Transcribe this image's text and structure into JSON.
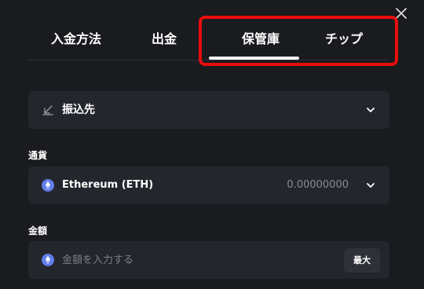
{
  "tabs": {
    "deposit": "入金方法",
    "withdraw": "出金",
    "vault": "保管庫",
    "tip": "チップ"
  },
  "destination": {
    "label": "振込先"
  },
  "currency": {
    "section_label": "通貨",
    "name": "Ethereum (ETH)",
    "balance": "0.00000000"
  },
  "amount": {
    "section_label": "金額",
    "placeholder": "金額を入力する",
    "max_label": "最大"
  },
  "colors": {
    "background": "#1a1b1f",
    "field": "#24262d",
    "highlight": "#e80d0d",
    "eth": "#627eea"
  },
  "icons": {
    "close": "close-icon",
    "destination": "arrow-down-left-icon",
    "currency": "ethereum-icon",
    "dropdown": "chevron-down-icon"
  }
}
